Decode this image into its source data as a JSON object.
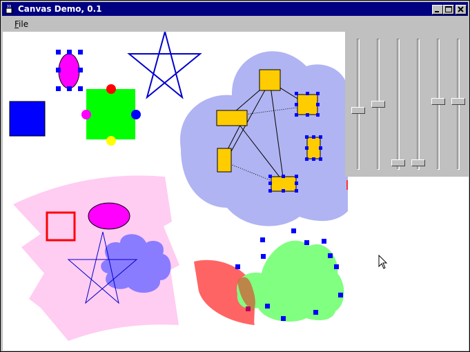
{
  "window": {
    "title": "Canvas Demo, 0.1",
    "minimize_icon": "minimize-icon",
    "maximize_icon": "maximize-icon",
    "close_icon": "close-icon",
    "app_icon": "coffee-cup-icon"
  },
  "menu": {
    "file_label": "File",
    "file_mnemonic": "F",
    "file_rest": "ile"
  },
  "canvas": {
    "colors": {
      "background": "#ffffff",
      "light_pink": "#ffccf2",
      "magenta": "#ff00ff",
      "red": "#ff0000",
      "blue": "#0000ff",
      "green": "#00ff00",
      "yellow": "#ffff00",
      "lavender_cloud": "#b0b4f2",
      "purple_cloud": "#8a7cff",
      "light_green_cloud": "#80ff80",
      "salmon": "#ff6464",
      "orange_node": "#ffcc00",
      "selection_handle": "#0000ff"
    },
    "sliders": {
      "count": 6,
      "levels": [
        0.55,
        0.5,
        0.97,
        0.97,
        0.48,
        0.48
      ]
    }
  }
}
